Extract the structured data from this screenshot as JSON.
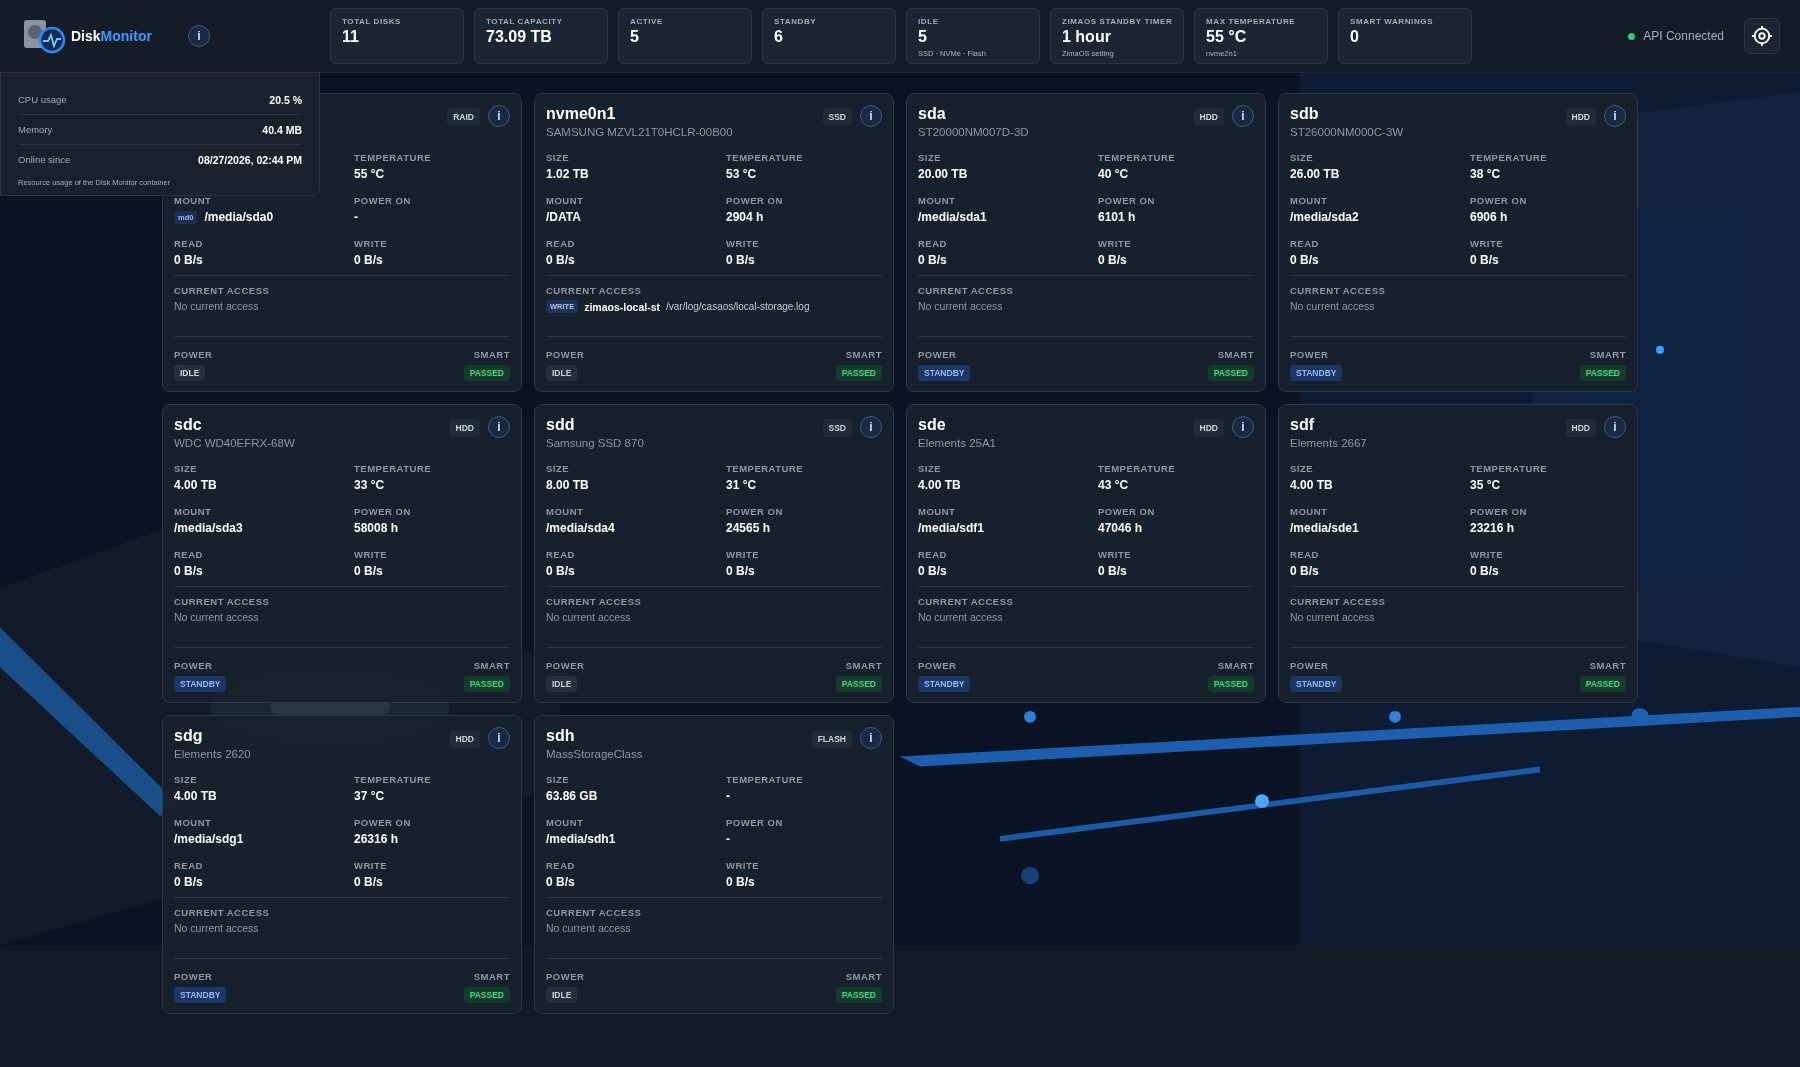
{
  "header": {
    "title_parts": [
      "Disk",
      "Monitor"
    ],
    "info_symbol": "i",
    "stats": [
      {
        "label": "TOTAL DISKS",
        "value": "11"
      },
      {
        "label": "TOTAL CAPACITY",
        "value": "73.09 TB"
      },
      {
        "label": "ACTIVE",
        "value": "5"
      },
      {
        "label": "STANDBY",
        "value": "6"
      },
      {
        "label": "IDLE",
        "value": "5",
        "sub": "SSD · NVMe · Flash"
      },
      {
        "label": "ZIMAOS STANDBY TIMER",
        "value": "1 hour",
        "sub": "ZimaOS setting"
      },
      {
        "label": "MAX TEMPERATURE",
        "value": "55 °C",
        "sub": "nvme2n1"
      },
      {
        "label": "SMART WARNINGS",
        "value": "0"
      }
    ],
    "api_status": {
      "label": "API Connected",
      "connected": true
    }
  },
  "resource_popup": {
    "rows": [
      {
        "label": "CPU usage",
        "value": "20.5 %"
      },
      {
        "label": "Memory",
        "value": "40.4 MB"
      },
      {
        "label": "Online since",
        "value": "08/27/2026, 02:44 PM"
      }
    ],
    "note": "Resource usage of the Disk Monitor container"
  },
  "disks": [
    {
      "type": "RAID",
      "info_symbol": "i",
      "fields": [
        {
          "label": "TEMPERATURE",
          "value": "55 °C"
        },
        {
          "label": "MOUNT",
          "tag": "md0",
          "value": "/media/sda0"
        },
        {
          "label": "POWER ON",
          "value": "-"
        },
        {
          "label": "READ",
          "value": "0 B/s"
        },
        {
          "label": "WRITE",
          "value": "0 B/s"
        }
      ],
      "access": {
        "label": "CURRENT ACCESS",
        "kind": "none",
        "text": "No current access"
      },
      "power": {
        "title": "POWER",
        "label": "IDLE",
        "kind": "idle"
      },
      "smart": {
        "title": "SMART",
        "label": "PASSED",
        "kind": "passed"
      }
    },
    {
      "name": "nvme0n1",
      "model": "SAMSUNG MZVL21T0HCLR-00B00",
      "type": "SSD",
      "info_symbol": "i",
      "fields": [
        {
          "label": "SIZE",
          "value": "1.02 TB"
        },
        {
          "label": "TEMPERATURE",
          "value": "53 °C"
        },
        {
          "label": "MOUNT",
          "value": "/DATA"
        },
        {
          "label": "POWER ON",
          "value": "2904 h"
        },
        {
          "label": "READ",
          "value": "0 B/s"
        },
        {
          "label": "WRITE",
          "value": "0 B/s"
        }
      ],
      "access": {
        "label": "CURRENT ACCESS",
        "kind": "entry",
        "op": "WRITE",
        "process": "zimaos-local-st",
        "path": "/var/log/casaos/local-storage.log"
      },
      "power": {
        "title": "POWER",
        "label": "IDLE",
        "kind": "idle"
      },
      "smart": {
        "title": "SMART",
        "label": "PASSED",
        "kind": "passed"
      }
    },
    {
      "name": "sda",
      "model": "ST20000NM007D-3D",
      "type": "HDD",
      "info_symbol": "i",
      "fields": [
        {
          "label": "SIZE",
          "value": "20.00 TB"
        },
        {
          "label": "TEMPERATURE",
          "value": "40 °C"
        },
        {
          "label": "MOUNT",
          "value": "/media/sda1"
        },
        {
          "label": "POWER ON",
          "value": "6101 h"
        },
        {
          "label": "READ",
          "value": "0 B/s"
        },
        {
          "label": "WRITE",
          "value": "0 B/s"
        }
      ],
      "access": {
        "label": "CURRENT ACCESS",
        "kind": "none",
        "text": "No current access"
      },
      "power": {
        "title": "POWER",
        "label": "STANDBY",
        "kind": "standby"
      },
      "smart": {
        "title": "SMART",
        "label": "PASSED",
        "kind": "passed"
      }
    },
    {
      "name": "sdb",
      "model": "ST26000NM000C-3W",
      "type": "HDD",
      "info_symbol": "i",
      "fields": [
        {
          "label": "SIZE",
          "value": "26.00 TB"
        },
        {
          "label": "TEMPERATURE",
          "value": "38 °C"
        },
        {
          "label": "MOUNT",
          "value": "/media/sda2"
        },
        {
          "label": "POWER ON",
          "value": "6906 h"
        },
        {
          "label": "READ",
          "value": "0 B/s"
        },
        {
          "label": "WRITE",
          "value": "0 B/s"
        }
      ],
      "access": {
        "label": "CURRENT ACCESS",
        "kind": "none",
        "text": "No current access"
      },
      "power": {
        "title": "POWER",
        "label": "STANDBY",
        "kind": "standby"
      },
      "smart": {
        "title": "SMART",
        "label": "PASSED",
        "kind": "passed"
      }
    },
    {
      "name": "sdc",
      "model": "WDC WD40EFRX-68W",
      "type": "HDD",
      "info_symbol": "i",
      "fields": [
        {
          "label": "SIZE",
          "value": "4.00 TB"
        },
        {
          "label": "TEMPERATURE",
          "value": "33 °C"
        },
        {
          "label": "MOUNT",
          "value": "/media/sda3"
        },
        {
          "label": "POWER ON",
          "value": "58008 h"
        },
        {
          "label": "READ",
          "value": "0 B/s"
        },
        {
          "label": "WRITE",
          "value": "0 B/s"
        }
      ],
      "access": {
        "label": "CURRENT ACCESS",
        "kind": "none",
        "text": "No current access"
      },
      "power": {
        "title": "POWER",
        "label": "STANDBY",
        "kind": "standby"
      },
      "smart": {
        "title": "SMART",
        "label": "PASSED",
        "kind": "passed"
      }
    },
    {
      "name": "sdd",
      "model": "Samsung SSD 870",
      "type": "SSD",
      "info_symbol": "i",
      "fields": [
        {
          "label": "SIZE",
          "value": "8.00 TB"
        },
        {
          "label": "TEMPERATURE",
          "value": "31 °C"
        },
        {
          "label": "MOUNT",
          "value": "/media/sda4"
        },
        {
          "label": "POWER ON",
          "value": "24565 h"
        },
        {
          "label": "READ",
          "value": "0 B/s"
        },
        {
          "label": "WRITE",
          "value": "0 B/s"
        }
      ],
      "access": {
        "label": "CURRENT ACCESS",
        "kind": "none",
        "text": "No current access"
      },
      "power": {
        "title": "POWER",
        "label": "IDLE",
        "kind": "idle"
      },
      "smart": {
        "title": "SMART",
        "label": "PASSED",
        "kind": "passed"
      }
    },
    {
      "name": "sde",
      "model": "Elements 25A1",
      "type": "HDD",
      "info_symbol": "i",
      "fields": [
        {
          "label": "SIZE",
          "value": "4.00 TB"
        },
        {
          "label": "TEMPERATURE",
          "value": "43 °C"
        },
        {
          "label": "MOUNT",
          "value": "/media/sdf1"
        },
        {
          "label": "POWER ON",
          "value": "47046 h"
        },
        {
          "label": "READ",
          "value": "0 B/s"
        },
        {
          "label": "WRITE",
          "value": "0 B/s"
        }
      ],
      "access": {
        "label": "CURRENT ACCESS",
        "kind": "none",
        "text": "No current access"
      },
      "power": {
        "title": "POWER",
        "label": "STANDBY",
        "kind": "standby"
      },
      "smart": {
        "title": "SMART",
        "label": "PASSED",
        "kind": "passed"
      }
    },
    {
      "name": "sdf",
      "model": "Elements 2667",
      "type": "HDD",
      "info_symbol": "i",
      "fields": [
        {
          "label": "SIZE",
          "value": "4.00 TB"
        },
        {
          "label": "TEMPERATURE",
          "value": "35 °C"
        },
        {
          "label": "MOUNT",
          "value": "/media/sde1"
        },
        {
          "label": "POWER ON",
          "value": "23216 h"
        },
        {
          "label": "READ",
          "value": "0 B/s"
        },
        {
          "label": "WRITE",
          "value": "0 B/s"
        }
      ],
      "access": {
        "label": "CURRENT ACCESS",
        "kind": "none",
        "text": "No current access"
      },
      "power": {
        "title": "POWER",
        "label": "STANDBY",
        "kind": "standby"
      },
      "smart": {
        "title": "SMART",
        "label": "PASSED",
        "kind": "passed"
      }
    },
    {
      "name": "sdg",
      "model": "Elements 2620",
      "type": "HDD",
      "info_symbol": "i",
      "fields": [
        {
          "label": "SIZE",
          "value": "4.00 TB"
        },
        {
          "label": "TEMPERATURE",
          "value": "37 °C"
        },
        {
          "label": "MOUNT",
          "value": "/media/sdg1"
        },
        {
          "label": "POWER ON",
          "value": "26316 h"
        },
        {
          "label": "READ",
          "value": "0 B/s"
        },
        {
          "label": "WRITE",
          "value": "0 B/s"
        }
      ],
      "access": {
        "label": "CURRENT ACCESS",
        "kind": "none",
        "text": "No current access"
      },
      "power": {
        "title": "POWER",
        "label": "STANDBY",
        "kind": "standby"
      },
      "smart": {
        "title": "SMART",
        "label": "PASSED",
        "kind": "passed"
      }
    },
    {
      "name": "sdh",
      "model": "MassStorageClass",
      "type": "FLASH",
      "info_symbol": "i",
      "fields": [
        {
          "label": "SIZE",
          "value": "63.86 GB"
        },
        {
          "label": "TEMPERATURE",
          "value": "-"
        },
        {
          "label": "MOUNT",
          "value": "/media/sdh1"
        },
        {
          "label": "POWER ON",
          "value": "-"
        },
        {
          "label": "READ",
          "value": "0 B/s"
        },
        {
          "label": "WRITE",
          "value": "0 B/s"
        }
      ],
      "access": {
        "label": "CURRENT ACCESS",
        "kind": "none",
        "text": "No current access"
      },
      "power": {
        "title": "POWER",
        "label": "IDLE",
        "kind": "idle"
      },
      "smart": {
        "title": "SMART",
        "label": "PASSED",
        "kind": "passed"
      }
    }
  ]
}
